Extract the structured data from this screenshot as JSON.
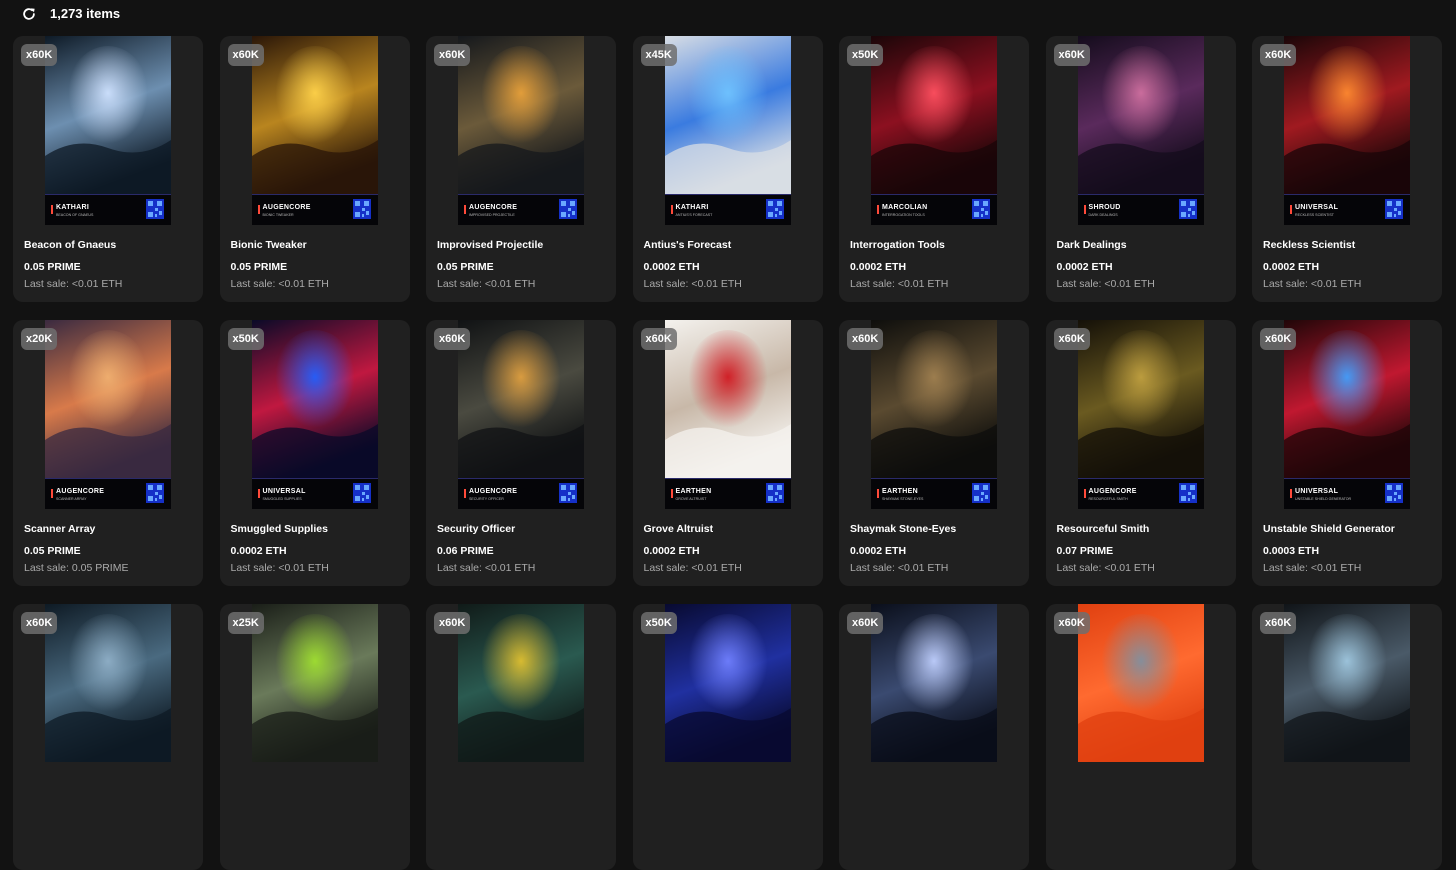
{
  "header": {
    "item_count": "1,273 items",
    "refresh_icon": "refresh-icon"
  },
  "colors": {
    "background": "#121212",
    "card": "#202020",
    "badge": "#6e6e6e",
    "muted_text": "#aaaaaa"
  },
  "cards": [
    {
      "badge": "x60K",
      "faction": "KATHARI",
      "subtitle": "Beacon of Gnaeus",
      "name": "Beacon of Gnaeus",
      "price": "0.05 PRIME",
      "last_sale": "Last sale: <0.01 ETH",
      "palette": [
        "#0e1a26",
        "#6d8fb0",
        "#cfe2ff"
      ]
    },
    {
      "badge": "x60K",
      "faction": "AUGENCORE",
      "subtitle": "Bionic Tweaker",
      "name": "Bionic Tweaker",
      "price": "0.05 PRIME",
      "last_sale": "Last sale: <0.01 ETH",
      "palette": [
        "#2a1608",
        "#b9851f",
        "#ffd24a"
      ]
    },
    {
      "badge": "x60K",
      "faction": "AUGENCORE",
      "subtitle": "Improvised Projectile",
      "name": "Improvised Projectile",
      "price": "0.05 PRIME",
      "last_sale": "Last sale: <0.01 ETH",
      "palette": [
        "#15181c",
        "#6b5a3a",
        "#e8a13a"
      ]
    },
    {
      "badge": "x45K",
      "faction": "KATHARI",
      "subtitle": "Antius's Forecast",
      "name": "Antius's Forecast",
      "price": "0.0002 ETH",
      "last_sale": "Last sale: <0.01 ETH",
      "palette": [
        "#d8dde4",
        "#3a7be0",
        "#6fc3ff"
      ]
    },
    {
      "badge": "x50K",
      "faction": "MARCOLIAN",
      "subtitle": "Interrogation Tools",
      "name": "Interrogation Tools",
      "price": "0.0002 ETH",
      "last_sale": "Last sale: <0.01 ETH",
      "palette": [
        "#1a0608",
        "#8c1020",
        "#ff5060"
      ]
    },
    {
      "badge": "x60K",
      "faction": "SHROUD",
      "subtitle": "Dark Dealings",
      "name": "Dark Dealings",
      "price": "0.0002 ETH",
      "last_sale": "Last sale: <0.01 ETH",
      "palette": [
        "#140c1c",
        "#5a2a5c",
        "#d070a0"
      ]
    },
    {
      "badge": "x60K",
      "faction": "UNIVERSAL",
      "subtitle": "Reckless Scientist",
      "name": "Reckless Scientist",
      "price": "0.0002 ETH",
      "last_sale": "Last sale: <0.01 ETH",
      "palette": [
        "#1a0608",
        "#a01a20",
        "#ff8a30"
      ]
    },
    {
      "badge": "x20K",
      "faction": "AUGENCORE",
      "subtitle": "Scanner Array",
      "name": "Scanner Array",
      "price": "0.05 PRIME",
      "last_sale": "Last sale: 0.05 PRIME",
      "palette": [
        "#3a2a40",
        "#d87a4a",
        "#f0b070"
      ]
    },
    {
      "badge": "x50K",
      "faction": "UNIVERSAL",
      "subtitle": "Smuggled Supplies",
      "name": "Smuggled Supplies",
      "price": "0.0002 ETH",
      "last_sale": "Last sale: <0.01 ETH",
      "palette": [
        "#0a0a28",
        "#c01840",
        "#2060ff"
      ]
    },
    {
      "badge": "x60K",
      "faction": "AUGENCORE",
      "subtitle": "Security Officer",
      "name": "Security Officer",
      "price": "0.06 PRIME",
      "last_sale": "Last sale: <0.01 ETH",
      "palette": [
        "#101214",
        "#4a4a40",
        "#e0a040"
      ]
    },
    {
      "badge": "x60K",
      "faction": "EARTHEN",
      "subtitle": "Grove Altruist",
      "name": "Grove Altruist",
      "price": "0.0002 ETH",
      "last_sale": "Last sale: <0.01 ETH",
      "palette": [
        "#f4f2ee",
        "#c8b8a8",
        "#d01820"
      ]
    },
    {
      "badge": "x60K",
      "faction": "EARTHEN",
      "subtitle": "Shaymak Stone-Eyes",
      "name": "Shaymak Stone-Eyes",
      "price": "0.0002 ETH",
      "last_sale": "Last sale: <0.01 ETH",
      "palette": [
        "#0e0e0c",
        "#5a4a30",
        "#a08050"
      ]
    },
    {
      "badge": "x60K",
      "faction": "AUGENCORE",
      "subtitle": "Resourceful Smith",
      "name": "Resourceful Smith",
      "price": "0.07 PRIME",
      "last_sale": "Last sale: <0.01 ETH",
      "palette": [
        "#141008",
        "#6a5a20",
        "#c0a040"
      ]
    },
    {
      "badge": "x60K",
      "faction": "UNIVERSAL",
      "subtitle": "Unstable Shield Generator",
      "name": "Unstable Shield Generator",
      "price": "0.0003 ETH",
      "last_sale": "Last sale: <0.01 ETH",
      "palette": [
        "#200608",
        "#c01830",
        "#40a0ff"
      ]
    },
    {
      "badge": "x60K",
      "faction": "",
      "subtitle": "",
      "name": "",
      "price": "",
      "last_sale": "",
      "palette": [
        "#0e1a24",
        "#4a6a80",
        "#90b0c8"
      ]
    },
    {
      "badge": "x25K",
      "faction": "",
      "subtitle": "",
      "name": "",
      "price": "",
      "last_sale": "",
      "palette": [
        "#1a1e18",
        "#6a7a5a",
        "#a0e030"
      ]
    },
    {
      "badge": "x60K",
      "faction": "",
      "subtitle": "",
      "name": "",
      "price": "",
      "last_sale": "",
      "palette": [
        "#101a18",
        "#2a5a50",
        "#e0c030"
      ]
    },
    {
      "badge": "x50K",
      "faction": "",
      "subtitle": "",
      "name": "",
      "price": "",
      "last_sale": "",
      "palette": [
        "#080a30",
        "#2030a0",
        "#7080ff"
      ]
    },
    {
      "badge": "x60K",
      "faction": "",
      "subtitle": "",
      "name": "",
      "price": "",
      "last_sale": "",
      "palette": [
        "#0a0e1a",
        "#3a4a70",
        "#c0d0ff"
      ]
    },
    {
      "badge": "x60K",
      "faction": "",
      "subtitle": "",
      "name": "",
      "price": "",
      "last_sale": "",
      "palette": [
        "#e04010",
        "#ff6a30",
        "#8090a0"
      ]
    },
    {
      "badge": "x60K",
      "faction": "",
      "subtitle": "",
      "name": "",
      "price": "",
      "last_sale": "",
      "palette": [
        "#101418",
        "#4a5a68",
        "#a0c8e0"
      ]
    }
  ]
}
